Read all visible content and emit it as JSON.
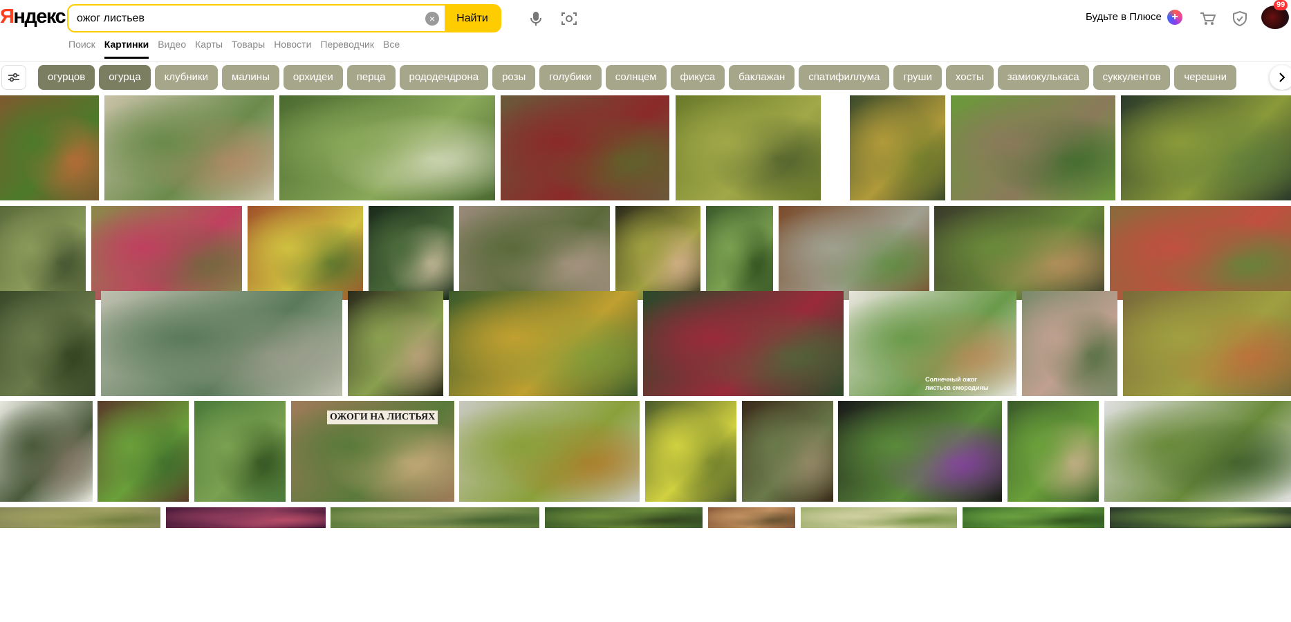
{
  "logo": {
    "first_letter": "Я",
    "rest": "ндекс"
  },
  "search": {
    "value": "ожог листьев",
    "button_label": "Найти"
  },
  "header": {
    "plus_text": "Будьте в Плюсе",
    "notifications_badge": "99"
  },
  "nav": {
    "items": [
      {
        "label": "Поиск"
      },
      {
        "label": "Картинки",
        "active": true
      },
      {
        "label": "Видео"
      },
      {
        "label": "Карты"
      },
      {
        "label": "Товары"
      },
      {
        "label": "Новости"
      },
      {
        "label": "Переводчик"
      },
      {
        "label": "Все"
      }
    ]
  },
  "chips": [
    {
      "label": "огурцов",
      "selected": true
    },
    {
      "label": "огурца",
      "selected": true
    },
    {
      "label": "клубники"
    },
    {
      "label": "малины"
    },
    {
      "label": "орхидеи"
    },
    {
      "label": "перца"
    },
    {
      "label": "рододендрона"
    },
    {
      "label": "розы"
    },
    {
      "label": "голубики"
    },
    {
      "label": "солнцем"
    },
    {
      "label": "фикуса"
    },
    {
      "label": "баклажан"
    },
    {
      "label": "спатифиллума"
    },
    {
      "label": "груши"
    },
    {
      "label": "хосты"
    },
    {
      "label": "замиокулькаса"
    },
    {
      "label": "суккулентов"
    },
    {
      "label": "черешни"
    }
  ],
  "thumb_texts": {
    "caption_burns": "ОЖОГИ НА ЛИСТЬЯХ",
    "caption_currant_1": "Солнечный ожог",
    "caption_currant_2": "листьев смородины"
  },
  "colors": {
    "brand_red": "#fc3f1d",
    "search_yellow": "#ffcc00",
    "chip_bg": "#a6a78a",
    "chip_selected_bg": "#7c7e62"
  },
  "icons": [
    "clear-icon",
    "microphone-icon",
    "camera-search-icon",
    "plus-icon",
    "cart-icon",
    "shield-icon",
    "filter-icon",
    "chevron-right-icon"
  ]
}
